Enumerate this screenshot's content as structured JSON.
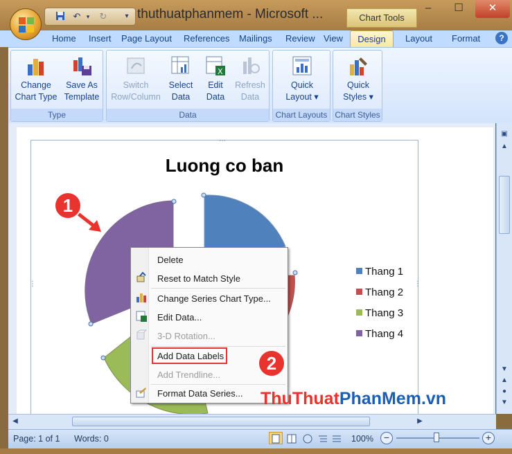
{
  "window": {
    "title": "thuthuatphanmem - Microsoft ...",
    "contextual_tab_group": "Chart Tools",
    "controls": {
      "minimize": "–",
      "maximize": "☐",
      "close": "✕"
    }
  },
  "tabs": [
    {
      "label": "Home"
    },
    {
      "label": "Insert"
    },
    {
      "label": "Page Layout"
    },
    {
      "label": "References"
    },
    {
      "label": "Mailings"
    },
    {
      "label": "Review"
    },
    {
      "label": "View"
    },
    {
      "label": "Design"
    },
    {
      "label": "Layout"
    },
    {
      "label": "Format"
    }
  ],
  "ribbon": {
    "type_group": {
      "label": "Type",
      "change_chart_type": "Change\nChart Type",
      "save_as_template": "Save As\nTemplate"
    },
    "data_group": {
      "label": "Data",
      "switch_row_column": "Switch\nRow/Column",
      "select_data": "Select\nData",
      "edit_data": "Edit\nData",
      "refresh_data": "Refresh\nData"
    },
    "chart_layouts_group": {
      "label": "Chart Layouts",
      "quick_layout": "Quick\nLayout ▾"
    },
    "chart_styles_group": {
      "label": "Chart Styles",
      "quick_styles": "Quick\nStyles ▾"
    }
  },
  "chart": {
    "title": "Luong co ban",
    "legend": [
      {
        "label": "Thang 1",
        "color": "#4f81bd"
      },
      {
        "label": "Thang 2",
        "color": "#c0504d"
      },
      {
        "label": "Thang 3",
        "color": "#9bbb59"
      },
      {
        "label": "Thang 4",
        "color": "#8064a2"
      }
    ]
  },
  "context_menu": {
    "items": [
      {
        "label": "Delete",
        "enabled": true
      },
      {
        "label": "Reset to Match Style",
        "enabled": true
      },
      {
        "label": "Change Series Chart Type...",
        "enabled": true
      },
      {
        "label": "Edit Data...",
        "enabled": true
      },
      {
        "label": "3-D Rotation...",
        "enabled": false
      },
      {
        "label": "Add Data Labels",
        "enabled": true
      },
      {
        "label": "Add Trendline...",
        "enabled": false
      },
      {
        "label": "Format Data Series...",
        "enabled": true
      }
    ]
  },
  "annotations": {
    "step1": "1",
    "step2": "2"
  },
  "watermark": {
    "part1": "ThuThuat",
    "part2": "PhanMem",
    "part3": ".vn"
  },
  "status": {
    "page": "Page: 1 of 1",
    "words": "Words: 0",
    "zoom": "100%"
  }
}
